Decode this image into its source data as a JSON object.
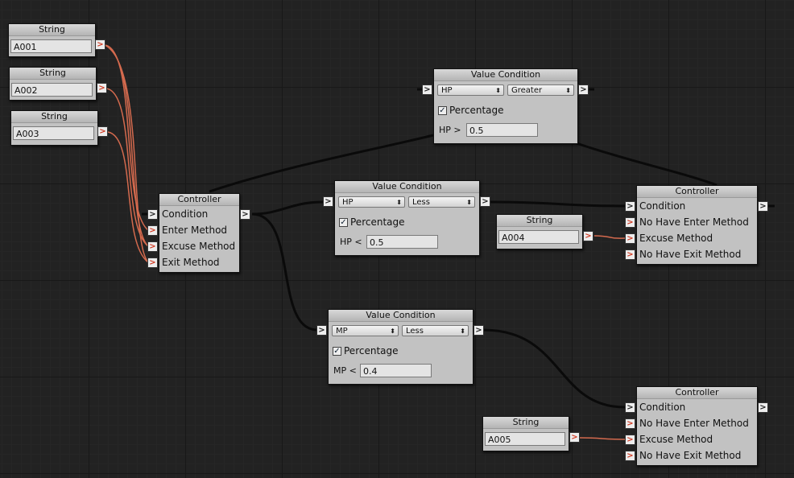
{
  "string_nodes": [
    {
      "title": "String",
      "value": "A001"
    },
    {
      "title": "String",
      "value": "A002"
    },
    {
      "title": "String",
      "value": "A003"
    },
    {
      "title": "String",
      "value": "A004"
    },
    {
      "title": "String",
      "value": "A005"
    }
  ],
  "controller_main": {
    "title": "Controller",
    "rows": [
      "Condition",
      "Enter Method",
      "Excuse Method",
      "Exit Method"
    ]
  },
  "value_conditions": [
    {
      "title": "Value Condition",
      "variable": "HP",
      "comparison": "Greater",
      "checkbox_label": "Percentage",
      "checked": "✓",
      "expr_var": "HP",
      "expr_op": ">",
      "threshold": "0.5"
    },
    {
      "title": "Value Condition",
      "variable": "HP",
      "comparison": "Less",
      "checkbox_label": "Percentage",
      "checked": "✓",
      "expr_var": "HP",
      "expr_op": "<",
      "threshold": "0.5"
    },
    {
      "title": "Value Condition",
      "variable": "MP",
      "comparison": "Less",
      "checkbox_label": "Percentage",
      "checked": "✓",
      "expr_var": "MP",
      "expr_op": "<",
      "threshold": "0.4"
    }
  ],
  "controller_sub": [
    {
      "title": "Controller",
      "rows": [
        "Condition",
        "No Have Enter Method",
        "Excuse Method",
        "No Have Exit Method"
      ]
    },
    {
      "title": "Controller",
      "rows": [
        "Condition",
        "No Have Enter Method",
        "Excuse Method",
        "No Have Exit Method"
      ]
    }
  ],
  "port_glyph": ">",
  "select_arrows": "⬍",
  "colors": {
    "wire_black": "#0a0a0a",
    "wire_string": "#d46a4e",
    "grid_bg": "#222222",
    "node_bg": "#c2c2c2"
  }
}
